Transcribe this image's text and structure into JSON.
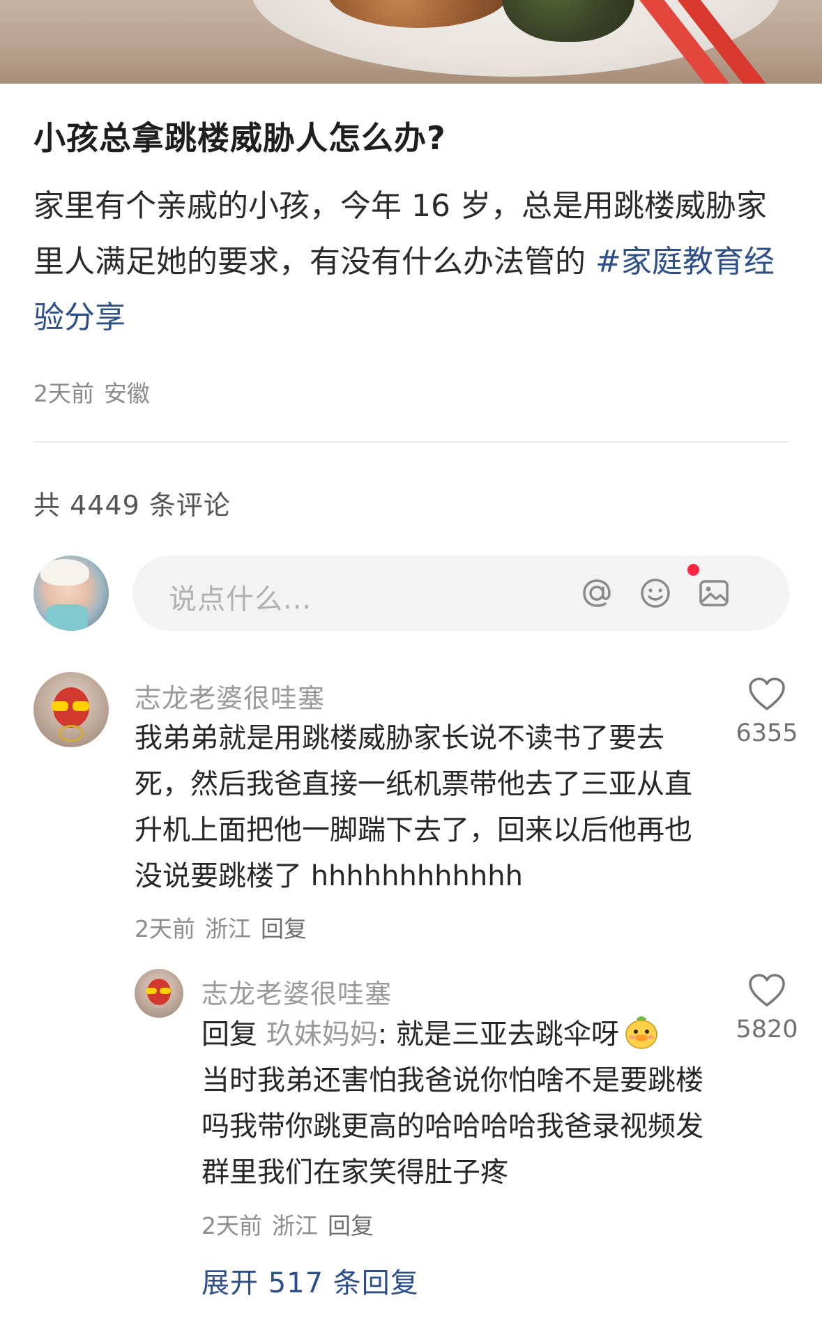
{
  "post": {
    "title": "小孩总拿跳楼威胁人怎么办?",
    "body_text": "家里有个亲戚的小孩，今年 16 岁，总是用跳楼威胁家里人满足她的要求，有没有什么办法管的 ",
    "hashtag": "#家庭教育经验分享",
    "time": "2天前",
    "location": "安徽"
  },
  "comments_header": {
    "count_label": "共 4449 条评论"
  },
  "comment_input": {
    "placeholder": "说点什么...",
    "icons": [
      "at-icon",
      "emoji-icon",
      "image-icon"
    ]
  },
  "comments": [
    {
      "author": "志龙老婆很哇塞",
      "text": "我弟弟就是用跳楼威胁家长说不读书了要去死，然后我爸直接一纸机票带他去了三亚从直升机上面把他一脚踹下去了，回来以后他再也没说要跳楼了 hhhhhhhhhhhh",
      "time": "2天前",
      "location": "浙江",
      "reply_label": "回复",
      "likes": "6355",
      "replies": [
        {
          "author": "志龙老婆很哇塞",
          "reply_prefix": "回复 ",
          "reply_to": "玖妹妈妈",
          "text_head": ": 就是三亚去跳伞呀",
          "text_tail": "当时我弟还害怕我爸说你怕啥不是要跳楼吗我带你跳更高的哈哈哈哈我爸录视频发群里我们在家笑得肚子疼",
          "time": "2天前",
          "location": "浙江",
          "reply_label": "回复",
          "likes": "5820"
        }
      ],
      "expand_label": "展开 517 条回复"
    }
  ],
  "colors": {
    "accent_link": "#2c4f8a",
    "notification_dot": "#ff2442"
  }
}
